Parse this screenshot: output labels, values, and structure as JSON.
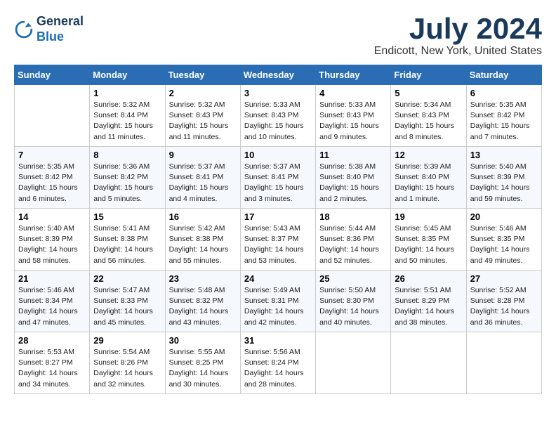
{
  "header": {
    "logo_line1": "General",
    "logo_line2": "Blue",
    "month": "July 2024",
    "location": "Endicott, New York, United States"
  },
  "days_of_week": [
    "Sunday",
    "Monday",
    "Tuesday",
    "Wednesday",
    "Thursday",
    "Friday",
    "Saturday"
  ],
  "weeks": [
    [
      {
        "day": "",
        "sunrise": "",
        "sunset": "",
        "daylight": ""
      },
      {
        "day": "1",
        "sunrise": "Sunrise: 5:32 AM",
        "sunset": "Sunset: 8:44 PM",
        "daylight": "Daylight: 15 hours and 11 minutes."
      },
      {
        "day": "2",
        "sunrise": "Sunrise: 5:32 AM",
        "sunset": "Sunset: 8:43 PM",
        "daylight": "Daylight: 15 hours and 11 minutes."
      },
      {
        "day": "3",
        "sunrise": "Sunrise: 5:33 AM",
        "sunset": "Sunset: 8:43 PM",
        "daylight": "Daylight: 15 hours and 10 minutes."
      },
      {
        "day": "4",
        "sunrise": "Sunrise: 5:33 AM",
        "sunset": "Sunset: 8:43 PM",
        "daylight": "Daylight: 15 hours and 9 minutes."
      },
      {
        "day": "5",
        "sunrise": "Sunrise: 5:34 AM",
        "sunset": "Sunset: 8:43 PM",
        "daylight": "Daylight: 15 hours and 8 minutes."
      },
      {
        "day": "6",
        "sunrise": "Sunrise: 5:35 AM",
        "sunset": "Sunset: 8:42 PM",
        "daylight": "Daylight: 15 hours and 7 minutes."
      }
    ],
    [
      {
        "day": "7",
        "sunrise": "Sunrise: 5:35 AM",
        "sunset": "Sunset: 8:42 PM",
        "daylight": "Daylight: 15 hours and 6 minutes."
      },
      {
        "day": "8",
        "sunrise": "Sunrise: 5:36 AM",
        "sunset": "Sunset: 8:42 PM",
        "daylight": "Daylight: 15 hours and 5 minutes."
      },
      {
        "day": "9",
        "sunrise": "Sunrise: 5:37 AM",
        "sunset": "Sunset: 8:41 PM",
        "daylight": "Daylight: 15 hours and 4 minutes."
      },
      {
        "day": "10",
        "sunrise": "Sunrise: 5:37 AM",
        "sunset": "Sunset: 8:41 PM",
        "daylight": "Daylight: 15 hours and 3 minutes."
      },
      {
        "day": "11",
        "sunrise": "Sunrise: 5:38 AM",
        "sunset": "Sunset: 8:40 PM",
        "daylight": "Daylight: 15 hours and 2 minutes."
      },
      {
        "day": "12",
        "sunrise": "Sunrise: 5:39 AM",
        "sunset": "Sunset: 8:40 PM",
        "daylight": "Daylight: 15 hours and 1 minute."
      },
      {
        "day": "13",
        "sunrise": "Sunrise: 5:40 AM",
        "sunset": "Sunset: 8:39 PM",
        "daylight": "Daylight: 14 hours and 59 minutes."
      }
    ],
    [
      {
        "day": "14",
        "sunrise": "Sunrise: 5:40 AM",
        "sunset": "Sunset: 8:39 PM",
        "daylight": "Daylight: 14 hours and 58 minutes."
      },
      {
        "day": "15",
        "sunrise": "Sunrise: 5:41 AM",
        "sunset": "Sunset: 8:38 PM",
        "daylight": "Daylight: 14 hours and 56 minutes."
      },
      {
        "day": "16",
        "sunrise": "Sunrise: 5:42 AM",
        "sunset": "Sunset: 8:38 PM",
        "daylight": "Daylight: 14 hours and 55 minutes."
      },
      {
        "day": "17",
        "sunrise": "Sunrise: 5:43 AM",
        "sunset": "Sunset: 8:37 PM",
        "daylight": "Daylight: 14 hours and 53 minutes."
      },
      {
        "day": "18",
        "sunrise": "Sunrise: 5:44 AM",
        "sunset": "Sunset: 8:36 PM",
        "daylight": "Daylight: 14 hours and 52 minutes."
      },
      {
        "day": "19",
        "sunrise": "Sunrise: 5:45 AM",
        "sunset": "Sunset: 8:35 PM",
        "daylight": "Daylight: 14 hours and 50 minutes."
      },
      {
        "day": "20",
        "sunrise": "Sunrise: 5:46 AM",
        "sunset": "Sunset: 8:35 PM",
        "daylight": "Daylight: 14 hours and 49 minutes."
      }
    ],
    [
      {
        "day": "21",
        "sunrise": "Sunrise: 5:46 AM",
        "sunset": "Sunset: 8:34 PM",
        "daylight": "Daylight: 14 hours and 47 minutes."
      },
      {
        "day": "22",
        "sunrise": "Sunrise: 5:47 AM",
        "sunset": "Sunset: 8:33 PM",
        "daylight": "Daylight: 14 hours and 45 minutes."
      },
      {
        "day": "23",
        "sunrise": "Sunrise: 5:48 AM",
        "sunset": "Sunset: 8:32 PM",
        "daylight": "Daylight: 14 hours and 43 minutes."
      },
      {
        "day": "24",
        "sunrise": "Sunrise: 5:49 AM",
        "sunset": "Sunset: 8:31 PM",
        "daylight": "Daylight: 14 hours and 42 minutes."
      },
      {
        "day": "25",
        "sunrise": "Sunrise: 5:50 AM",
        "sunset": "Sunset: 8:30 PM",
        "daylight": "Daylight: 14 hours and 40 minutes."
      },
      {
        "day": "26",
        "sunrise": "Sunrise: 5:51 AM",
        "sunset": "Sunset: 8:29 PM",
        "daylight": "Daylight: 14 hours and 38 minutes."
      },
      {
        "day": "27",
        "sunrise": "Sunrise: 5:52 AM",
        "sunset": "Sunset: 8:28 PM",
        "daylight": "Daylight: 14 hours and 36 minutes."
      }
    ],
    [
      {
        "day": "28",
        "sunrise": "Sunrise: 5:53 AM",
        "sunset": "Sunset: 8:27 PM",
        "daylight": "Daylight: 14 hours and 34 minutes."
      },
      {
        "day": "29",
        "sunrise": "Sunrise: 5:54 AM",
        "sunset": "Sunset: 8:26 PM",
        "daylight": "Daylight: 14 hours and 32 minutes."
      },
      {
        "day": "30",
        "sunrise": "Sunrise: 5:55 AM",
        "sunset": "Sunset: 8:25 PM",
        "daylight": "Daylight: 14 hours and 30 minutes."
      },
      {
        "day": "31",
        "sunrise": "Sunrise: 5:56 AM",
        "sunset": "Sunset: 8:24 PM",
        "daylight": "Daylight: 14 hours and 28 minutes."
      },
      {
        "day": "",
        "sunrise": "",
        "sunset": "",
        "daylight": ""
      },
      {
        "day": "",
        "sunrise": "",
        "sunset": "",
        "daylight": ""
      },
      {
        "day": "",
        "sunrise": "",
        "sunset": "",
        "daylight": ""
      }
    ]
  ]
}
